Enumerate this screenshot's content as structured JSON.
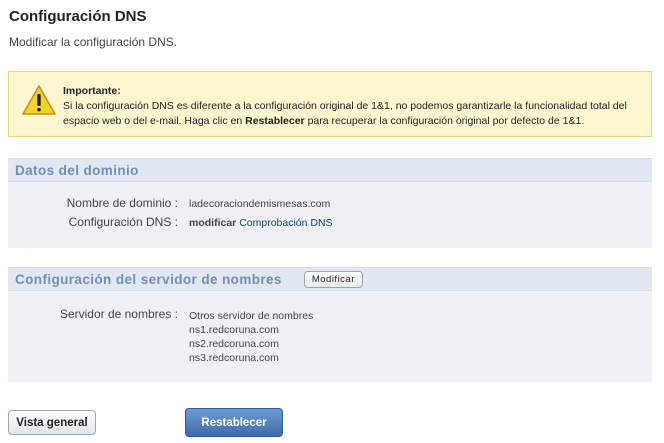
{
  "page": {
    "title": "Configuración DNS",
    "subtitle": "Modificar la configuración DNS."
  },
  "warning": {
    "icon": "warning-icon",
    "title": "Importante:",
    "text_before": "Si la configuración DNS es diferente a la configuración original de 1&1, no podemos garantizarle la funcionalidad total del espacio web o del e-mail. Haga clic en ",
    "emphasis": "Restablecer",
    "text_after": " para recuperar la configuración original por defecto de 1&1."
  },
  "domain_section": {
    "title": "Datos del dominio",
    "domain_label": "Nombre de dominio :",
    "domain_value": "ladecoraciondemismesas.com",
    "dns_label": "Configuración DNS :",
    "dns_value": "modificar",
    "dns_link": "Comprobación DNS"
  },
  "ns_section": {
    "title": "Configuración del servidor de nombres",
    "modify_button": "Modificar",
    "servers_label": "Servidor de nombres :",
    "servers": [
      "Otros servidor de nombres",
      "ns1.redcoruna.com",
      "ns2.redcoruna.com",
      "ns3.redcoruna.com"
    ]
  },
  "buttons": {
    "overview": "Vista general",
    "reset": "Restablecer"
  },
  "colors": {
    "section_title": "#6f8fb6",
    "warning_bg": "#fdf7d0",
    "primary_button": "#4a78b5"
  }
}
